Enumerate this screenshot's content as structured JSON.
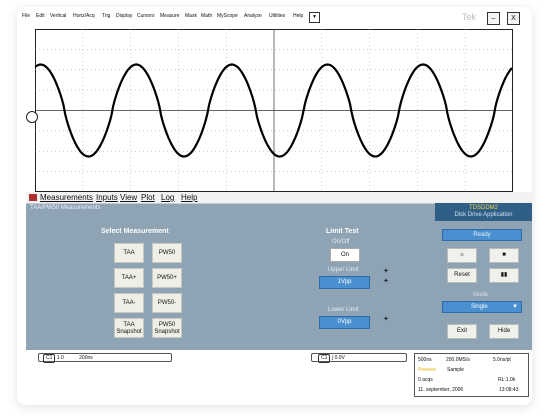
{
  "menu": [
    "File",
    "Edit",
    "Vertical",
    "Horiz/Acq",
    "Trig",
    "Display",
    "Cursors",
    "Measure",
    "Mask",
    "Math",
    "MyScope",
    "Analyze",
    "Utilities",
    "Help"
  ],
  "window": {
    "brand": "Tek",
    "minimize": "–",
    "close": "X",
    "dropdown": "▼"
  },
  "app": {
    "menu": [
      "Measurements",
      "Inputs",
      "View",
      "Plot",
      "Log",
      "Help"
    ],
    "title": "TAA/PW50 Measurements",
    "brand_line1": "TDSDDM2",
    "brand_line2": "Disk Drive Application",
    "select_title": "Select Measurement",
    "buttons": {
      "taa": "TAA",
      "pw50": "PW50",
      "taa_plus": "TAA+",
      "pw50_plus": "PW50+",
      "taa_minus": "TAA-",
      "pw50_minus": "PW50-",
      "taa_snapshot_1": "TAA",
      "taa_snapshot_2": "Snapshot",
      "pw50_snapshot_1": "PW50",
      "pw50_snapshot_2": "Snapshot"
    },
    "limit_test": {
      "title": "Limit Test",
      "onoff_label": "On/Off",
      "onoff_value": "On",
      "upper_label": "Upper Limit",
      "upper_value": "1Vpp",
      "lower_label": "Lower Limit",
      "lower_value": "0Vpp"
    },
    "control": {
      "status": "Ready",
      "reset": "Reset",
      "mode_label": "Mode",
      "mode_value": "Single",
      "exit": "Exit",
      "hide": "Hide"
    }
  },
  "status": {
    "ch_scale_channel": "C1",
    "ch_scale": "1.0",
    "timebase": "200ns",
    "trig_channel": "C1",
    "trig_level": "0.0V",
    "acq": {
      "record_time": "500ns",
      "sample_rate": "200.0MS/s",
      "per_pt": "5.0ns/pt",
      "state": "Preview",
      "mode": "Sample",
      "acqs": "0 acqs",
      "rl": "RL:1.0k",
      "date": "11. september, 2006",
      "time": "13:08:43"
    }
  },
  "colors": {
    "panel": "#8ea3b3",
    "accent": "#4a8fd0",
    "brand_bg": "#2f5f86",
    "brand_text": "#f4d34a",
    "preview": "#e0b400"
  }
}
